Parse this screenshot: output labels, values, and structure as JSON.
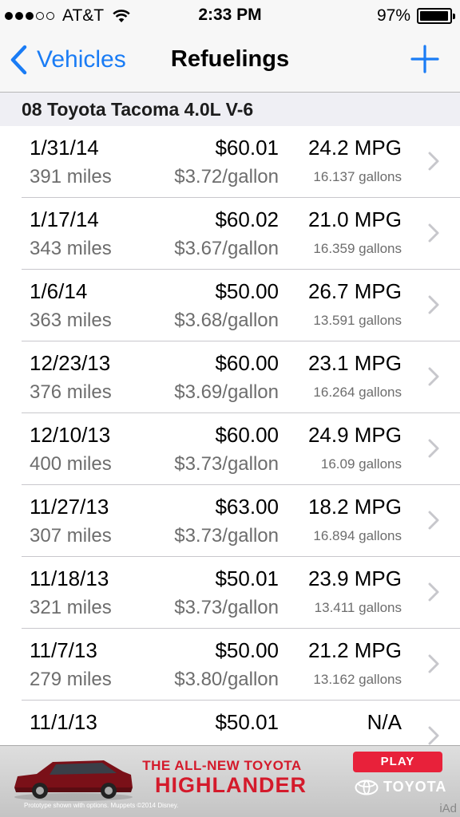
{
  "status_bar": {
    "carrier": "AT&T",
    "time": "2:33 PM",
    "battery_percent": "97%",
    "battery_level": 0.97,
    "signal_bars_filled": 3,
    "signal_bars_total": 5
  },
  "nav": {
    "back_label": "Vehicles",
    "title": "Refuelings",
    "accent_color": "#1a7cf5"
  },
  "section": {
    "vehicle": "08 Toyota Tacoma 4.0L V-6"
  },
  "refuelings": [
    {
      "date": "1/31/14",
      "miles": "391 miles",
      "cost": "$60.01",
      "price_per_gallon": "$3.72/gallon",
      "mpg": "24.2 MPG",
      "gallons": "16.137 gallons"
    },
    {
      "date": "1/17/14",
      "miles": "343 miles",
      "cost": "$60.02",
      "price_per_gallon": "$3.67/gallon",
      "mpg": "21.0 MPG",
      "gallons": "16.359 gallons"
    },
    {
      "date": "1/6/14",
      "miles": "363 miles",
      "cost": "$50.00",
      "price_per_gallon": "$3.68/gallon",
      "mpg": "26.7 MPG",
      "gallons": "13.591 gallons"
    },
    {
      "date": "12/23/13",
      "miles": "376 miles",
      "cost": "$60.00",
      "price_per_gallon": "$3.69/gallon",
      "mpg": "23.1 MPG",
      "gallons": "16.264 gallons"
    },
    {
      "date": "12/10/13",
      "miles": "400 miles",
      "cost": "$60.00",
      "price_per_gallon": "$3.73/gallon",
      "mpg": "24.9 MPG",
      "gallons": "16.09 gallons"
    },
    {
      "date": "11/27/13",
      "miles": "307 miles",
      "cost": "$63.00",
      "price_per_gallon": "$3.73/gallon",
      "mpg": "18.2 MPG",
      "gallons": "16.894 gallons"
    },
    {
      "date": "11/18/13",
      "miles": "321 miles",
      "cost": "$50.01",
      "price_per_gallon": "$3.73/gallon",
      "mpg": "23.9 MPG",
      "gallons": "13.411 gallons"
    },
    {
      "date": "11/7/13",
      "miles": "279 miles",
      "cost": "$50.00",
      "price_per_gallon": "$3.80/gallon",
      "mpg": "21.2 MPG",
      "gallons": "13.162 gallons"
    },
    {
      "date": "11/1/13",
      "miles": "",
      "cost": "$50.01",
      "price_per_gallon": "",
      "mpg": "N/A",
      "gallons": ""
    }
  ],
  "ad": {
    "headline": "THE ALL-NEW TOYOTA",
    "model": "HIGHLANDER",
    "play_label": "PLAY",
    "brand": "TOYOTA",
    "disclaimer": "Prototype shown with options. Muppets ©2014 Disney.",
    "network_label": "iAd",
    "accent_color": "#d41a2b"
  }
}
